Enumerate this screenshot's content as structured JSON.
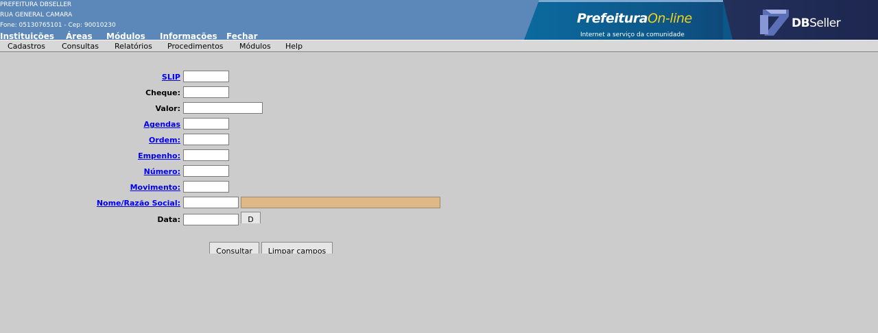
{
  "header": {
    "org_name": "PREFEITURA DBSELLER",
    "address": "RUA GENERAL CAMARA",
    "contact": "Fone: 05130765101  - Cep: 90010230",
    "nav": [
      "Instituições",
      "Áreas",
      "Módulos",
      "Informações",
      "Fechar"
    ],
    "banner": {
      "brand_main": "Prefeitura",
      "brand_accent": "On-line",
      "tagline": "Internet a serviço da comunidade",
      "company_bold": "DB",
      "company_rest": "Seller"
    }
  },
  "menu": [
    "Cadastros",
    "Consultas",
    "Relatórios",
    "Procedimentos",
    "Módulos",
    "Help"
  ],
  "form": {
    "slip_label": "SLIP",
    "cheque_label": "Cheque:",
    "valor_label": "Valor:",
    "agendas_label": "Agendas",
    "ordem_label": "Ordem:",
    "empenho_label": "Empenho:",
    "numero_label": "Número:",
    "movimento_label": "Movimento:",
    "nome_label": "Nome/Razão Social:",
    "data_label": "Data:",
    "date_button": "D",
    "consultar_button": "Consultar",
    "limpar_button": "Limpar campos"
  },
  "colors": {
    "background": "#cccccc",
    "header": "#5b88b8",
    "link": "#0000ee",
    "readonly_field": "#deb887",
    "brand_accent": "#f5d21b"
  }
}
